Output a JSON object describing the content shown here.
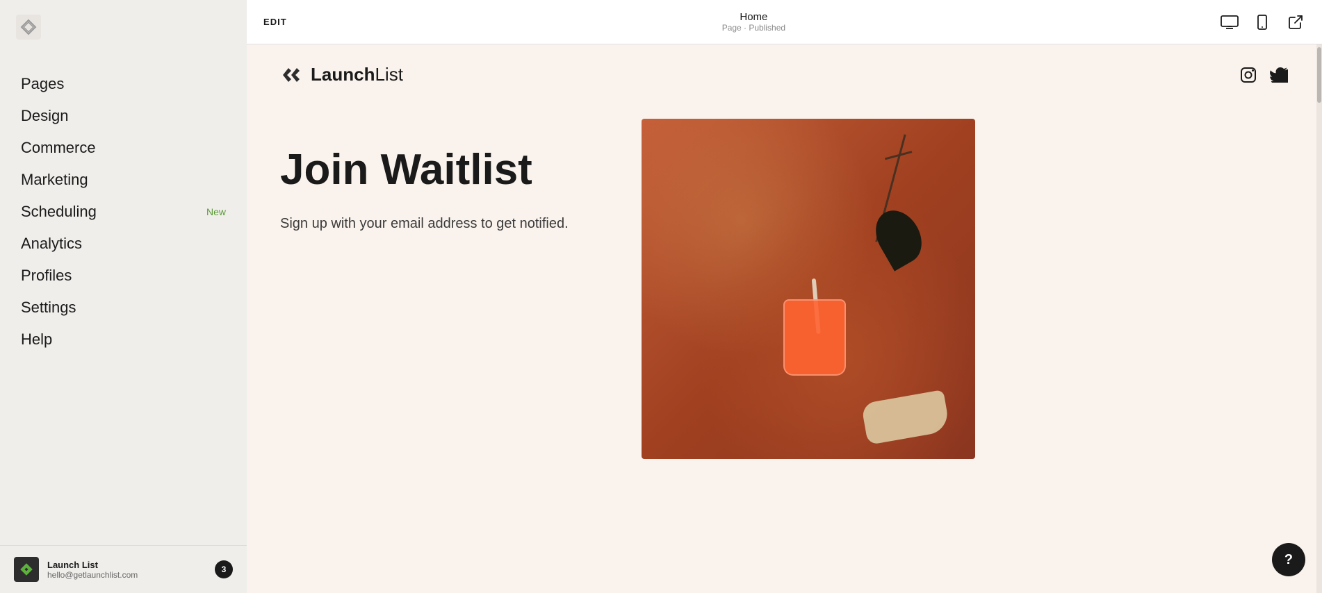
{
  "sidebar": {
    "logo_alt": "Squarespace",
    "nav_items": [
      {
        "id": "pages",
        "label": "Pages",
        "badge": null
      },
      {
        "id": "design",
        "label": "Design",
        "badge": null
      },
      {
        "id": "commerce",
        "label": "Commerce",
        "badge": null
      },
      {
        "id": "marketing",
        "label": "Marketing",
        "badge": null
      },
      {
        "id": "scheduling",
        "label": "Scheduling",
        "badge": "New"
      },
      {
        "id": "analytics",
        "label": "Analytics",
        "badge": null
      },
      {
        "id": "profiles",
        "label": "Profiles",
        "badge": null
      },
      {
        "id": "settings",
        "label": "Settings",
        "badge": null
      },
      {
        "id": "help",
        "label": "Help",
        "badge": null
      }
    ],
    "footer": {
      "name": "Launch List",
      "email": "hello@getlaunchlist.com",
      "notification_count": "3"
    }
  },
  "topbar": {
    "edit_label": "EDIT",
    "page_title": "Home",
    "page_subtitle": "Page · Published"
  },
  "preview": {
    "site_logo_bold": "Launch",
    "site_logo_light": "List",
    "heading": "Join Waitlist",
    "subtext": "Sign up with your email address to get notified.",
    "instagram_icon": "instagram",
    "twitter_icon": "twitter"
  },
  "help": {
    "label": "?"
  }
}
